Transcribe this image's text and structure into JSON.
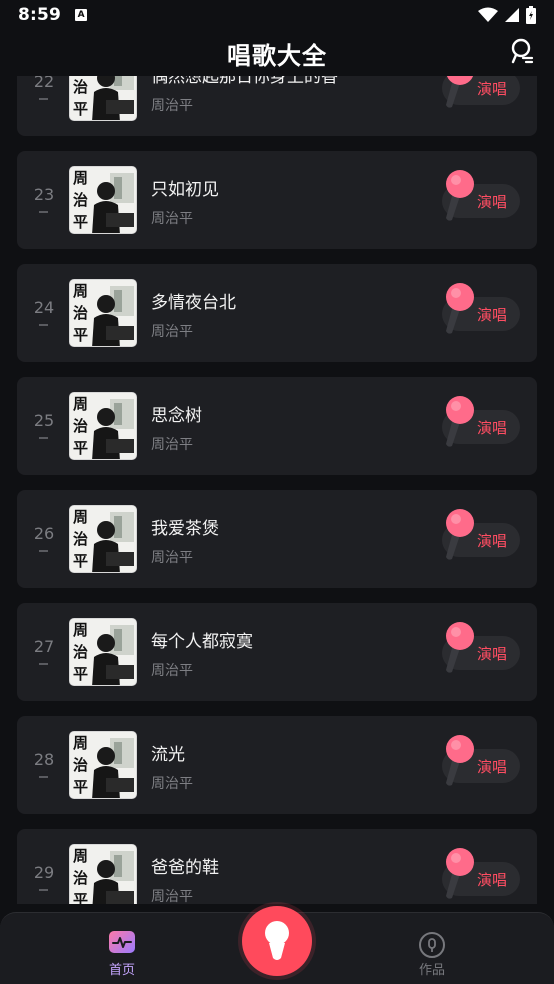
{
  "status": {
    "time": "8:59",
    "notif_glyph": "A"
  },
  "header": {
    "title": "唱歌大全",
    "action_icon": "mic-search-icon"
  },
  "colors": {
    "accent": "#ff4a5c",
    "sing_text": "#ff4d62",
    "card": "#1e1f23",
    "background": "#0f1013"
  },
  "songs": [
    {
      "rank": "22",
      "title": "偶然想起那日你身上的香",
      "artist": "周治平",
      "action": "演唱"
    },
    {
      "rank": "23",
      "title": "只如初见",
      "artist": "周治平",
      "action": "演唱"
    },
    {
      "rank": "24",
      "title": "多情夜台北",
      "artist": "周治平",
      "action": "演唱"
    },
    {
      "rank": "25",
      "title": "思念树",
      "artist": "周治平",
      "action": "演唱"
    },
    {
      "rank": "26",
      "title": "我爱茶煲",
      "artist": "周治平",
      "action": "演唱"
    },
    {
      "rank": "27",
      "title": "每个人都寂寞",
      "artist": "周治平",
      "action": "演唱"
    },
    {
      "rank": "28",
      "title": "流光",
      "artist": "周治平",
      "action": "演唱"
    },
    {
      "rank": "29",
      "title": "爸爸的鞋",
      "artist": "周治平",
      "action": "演唱"
    }
  ],
  "cover": {
    "text": "周治平"
  },
  "tabs": {
    "home": "首页",
    "works": "作品"
  }
}
